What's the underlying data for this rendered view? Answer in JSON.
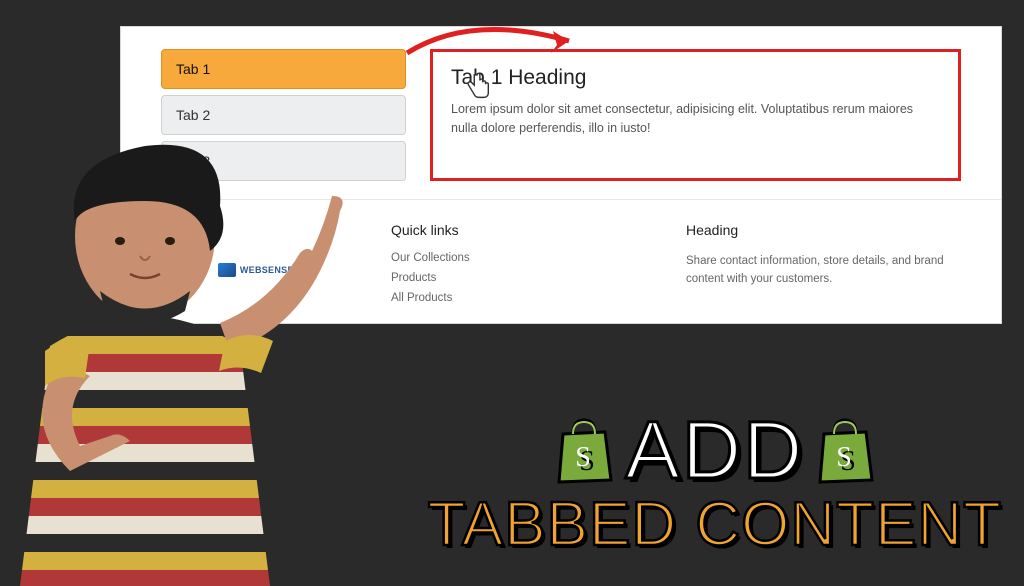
{
  "tabs": {
    "items": [
      {
        "label": "Tab 1",
        "active": true
      },
      {
        "label": "Tab 2",
        "active": false
      },
      {
        "label": "Tab 3",
        "active": false
      }
    ],
    "content": {
      "heading": "Tab 1 Heading",
      "body": "Lorem ipsum dolor sit amet consectetur, adipisicing elit. Voluptatibus rerum maiores nulla dolore perferendis, illo in iusto!"
    }
  },
  "footer": {
    "logo_text": "WEBSENSEPRO",
    "quicklinks": {
      "heading": "Quick links",
      "links": [
        "Our Collections",
        "Products",
        "All Products"
      ]
    },
    "info": {
      "heading": "Heading",
      "text": "Share contact information, store details, and brand content with your customers."
    }
  },
  "overlay": {
    "line1": "ADD",
    "line2": "TABBED CONTENT"
  },
  "colors": {
    "active_tab": "#f7a93b",
    "highlight_border": "#e02020",
    "arrow": "#e02020",
    "shopify": "#7aa93c"
  }
}
